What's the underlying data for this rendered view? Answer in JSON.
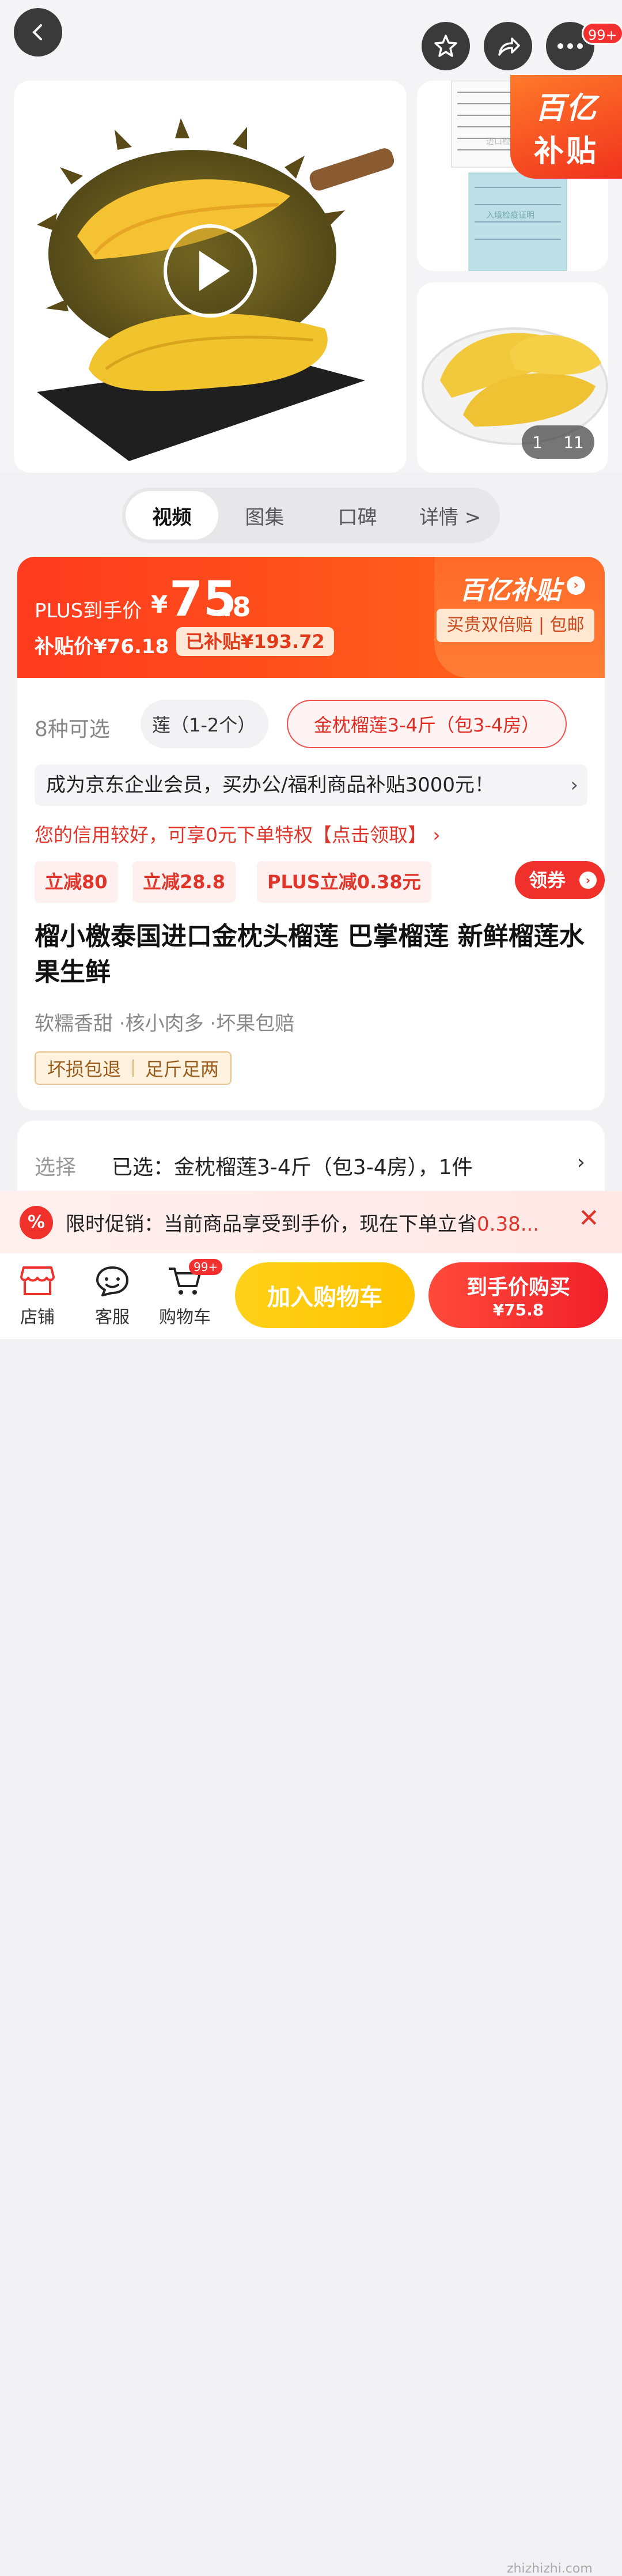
{
  "header": {
    "back_icon": "back-arrow-icon",
    "star_icon": "star-icon",
    "share_icon": "share-icon",
    "more_icon": "more-dots-icon",
    "more_badge": "99+"
  },
  "gallery": {
    "subsidy_corner": {
      "line1": "百亿",
      "line2": "补贴"
    },
    "page_current": "1",
    "page_total": "11",
    "doc_caption": "进口检疫",
    "doc_caption2": "入境检疫证明"
  },
  "tabs": [
    {
      "label": "视频",
      "active": true
    },
    {
      "label": "图集",
      "active": false
    },
    {
      "label": "口碑",
      "active": false
    },
    {
      "label": "详情 >",
      "active": false
    }
  ],
  "price": {
    "plus_label": "PLUS到手价",
    "currency": "¥",
    "integer": "75",
    "decimal": ".8",
    "subsidy_price": "补贴价¥76.18",
    "subsidy_tag": "已补贴¥193.72",
    "brand_title": "百亿补贴",
    "brand_arrow": "›",
    "brand_pill": "买贵双倍赔 | 包邮"
  },
  "variants": {
    "count_label": "8种可选",
    "chip1": "莲（1-2个）",
    "chip2": "金枕榴莲3-4斤（包3-4房）"
  },
  "corp_banner": "成为京东企业会员，买办公/福利商品补贴3000元！",
  "corp_chevron": "›",
  "credit_line": "您的信用较好，可享0元下单特权【点击领取】 ›",
  "coupons": [
    "立减80",
    "立减28.8",
    "PLUS立减0.38元"
  ],
  "get_coupon": "领券",
  "get_coupon_arrow": "›",
  "product_title": "榴小檄泰国进口金枕头榴莲 巴掌榴莲 新鲜榴莲水果生鲜",
  "features": "软糯香甜 ·核小肉多 ·坏果包赔",
  "guarantee": [
    "坏损包退",
    "足斤足两"
  ],
  "selection": {
    "label": "选择",
    "value": "已选：金枕榴莲3-4斤（包3-4房），1件",
    "chevron": "›"
  },
  "promo": {
    "icon": "%",
    "text": "限时促销：当前商品享受到手价，现在下单立省",
    "amount": "0.38...",
    "close": "✕"
  },
  "bottom_nav": [
    {
      "label": "店铺",
      "icon": "store-icon"
    },
    {
      "label": "客服",
      "icon": "customer-service-icon"
    },
    {
      "label": "购物车",
      "icon": "cart-icon",
      "badge": "99+"
    }
  ],
  "add_to_cart": "加入购物车",
  "buy_now": {
    "line1": "到手价购买",
    "line2": "¥75.8"
  },
  "watermark": "zhizhizhi.com",
  "colors": {
    "accent": "#f0302a",
    "cart_button": "#ffc300",
    "banner": "#ff4a1e"
  }
}
